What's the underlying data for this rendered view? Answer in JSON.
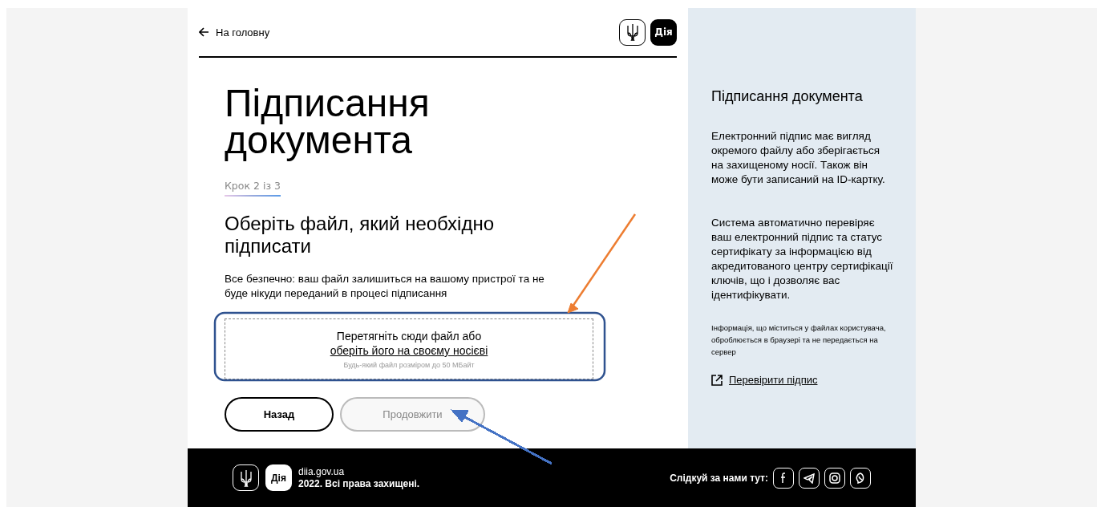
{
  "header": {
    "back_link": "На головну",
    "logo_text": "Дія"
  },
  "title": "Підписання документа",
  "step": "Крок 2 із 3",
  "heading": "Оберіть файл, який необхідно підписати",
  "note": "Все безпечно: ваш файл залишиться на вашому пристрої та не буде нікуди переданий в процесі підписання",
  "dropzone": {
    "text": "Перетягніть сюди файл або",
    "link": "оберіть його на своєму носієві",
    "hint": "Будь-який файл розміром до 50 МБайт"
  },
  "buttons": [
    {
      "label": "Назад",
      "disabled": false
    },
    {
      "label": "Продовжити",
      "disabled": true
    }
  ],
  "sidebar": {
    "title": "Підписання документа",
    "paragraphs": [
      "Електронний підпис має вигляд окремого файлу або зберігається на захищеному носії. Також він може бути записаний на ID-картку.",
      "Система автоматично перевіряє ваш електронний підпис та статус сертифікату за інформацією від акредитованого центру сертифікації ключів, що і дозволяє вас ідентифікувати."
    ],
    "small_note": "Інформація, що міститься у файлах користувача, оброблюється в браузері та не передається на сервер",
    "link": "Перевірити підпис"
  },
  "footer": {
    "logo_text": "Дія",
    "site": "diia.gov.ua",
    "copyright": "2022. Всі права захищені.",
    "follow": "Слідкуй за нами тут:"
  },
  "annotations": [
    {
      "kind": "frame",
      "color": "#2f528f"
    },
    {
      "kind": "arrow",
      "color": "#ed7d31"
    },
    {
      "kind": "arrow",
      "color": "#4472c4"
    }
  ]
}
